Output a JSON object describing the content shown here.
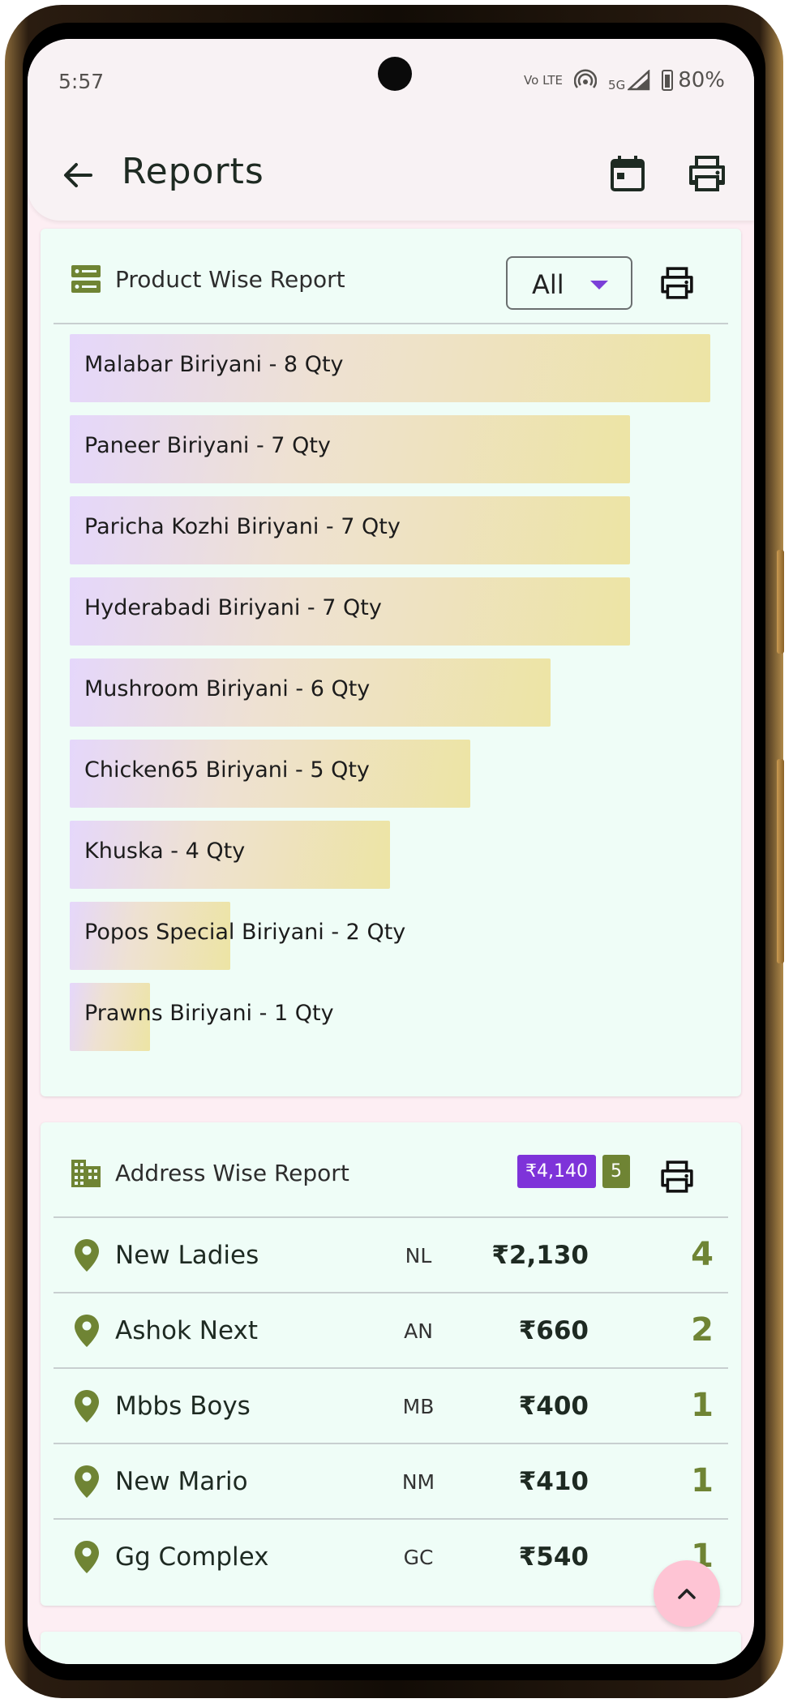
{
  "status_bar": {
    "time": "5:57",
    "volte_label": "Vo LTE",
    "network_label": "5G",
    "battery": "80%"
  },
  "app_bar": {
    "title": "Reports",
    "back_icon": "arrow-left-icon",
    "calendar_icon": "calendar-icon",
    "print_icon": "printer-icon"
  },
  "product_report": {
    "title": "Product Wise Report",
    "icon": "storage-icon",
    "filter_value": "All",
    "print_icon": "printer-icon",
    "items": [
      {
        "label": "Malabar Biriyani - 8 Qty",
        "qty": 8
      },
      {
        "label": "Paneer Biriyani - 7 Qty",
        "qty": 7
      },
      {
        "label": "Paricha Kozhi Biriyani - 7 Qty",
        "qty": 7
      },
      {
        "label": "Hyderabadi Biriyani - 7 Qty",
        "qty": 7
      },
      {
        "label": "Mushroom Biriyani - 6 Qty",
        "qty": 6
      },
      {
        "label": "Chicken65 Biriyani - 5 Qty",
        "qty": 5
      },
      {
        "label": "Khuska - 4 Qty",
        "qty": 4
      },
      {
        "label": "Popos Special Biriyani - 2 Qty",
        "qty": 2
      },
      {
        "label": "Prawns Biriyani - 1 Qty",
        "qty": 1
      }
    ],
    "max_qty": 8
  },
  "address_report": {
    "title": "Address Wise Report",
    "icon": "building-icon",
    "total_amount": "₹4,140",
    "total_count": "5",
    "print_icon": "printer-icon",
    "rows": [
      {
        "name": "New Ladies",
        "code": "NL",
        "amount": "₹2,130",
        "count": "4"
      },
      {
        "name": "Ashok Next",
        "code": "AN",
        "amount": "₹660",
        "count": "2"
      },
      {
        "name": "Mbbs Boys",
        "code": "MB",
        "amount": "₹400",
        "count": "1"
      },
      {
        "name": "New Mario",
        "code": "NM",
        "amount": "₹410",
        "count": "1"
      },
      {
        "name": "Gg Complex",
        "code": "GC",
        "amount": "₹540",
        "count": "1"
      }
    ]
  },
  "colors": {
    "card_bg": "#effdf7",
    "screen_bg": "#fdeef3",
    "accent_purple": "#7e33d9",
    "accent_olive": "#6f8434",
    "fab_bg": "#fec4d4"
  },
  "fab_icon": "chevron-up-icon"
}
